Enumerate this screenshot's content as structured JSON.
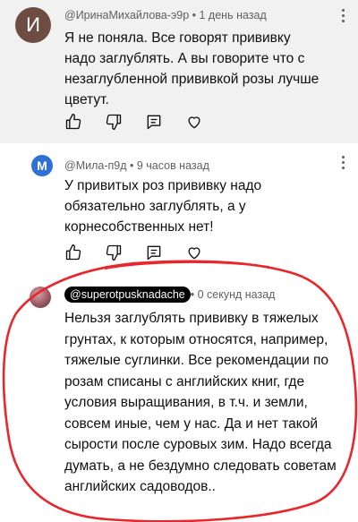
{
  "comments": [
    {
      "avatar_letter": "И",
      "avatar_color": "#6d4c41",
      "author": "@ИринаМихайлова-э9р",
      "time": " • 1 день назад",
      "lines": [
        "Я не поняла. Все говорят прививку",
        "надо заглублять. А вы говорите что с",
        "незаглубленной прививкой розы лучше",
        "цветут."
      ],
      "highlighted": true
    },
    {
      "avatar_letter": "M",
      "avatar_color": "#2f6fd8",
      "author": "@Мила-п9д",
      "time": " • 9 часов назад",
      "lines": [
        "У привитых роз прививку надо",
        "обязательно заглублять, а у",
        "корнесобственных нет!"
      ]
    },
    {
      "author": "@superotpusknadache",
      "time": " • 0 секунд назад",
      "lines": [
        "Нельзя заглублять прививку в тяжелых",
        "грунтах, к которым относятся, например,",
        "тяжелые суглинки. Все рекомендации по",
        "розам списаны с английских книг, где",
        "условия выращивания, в т.ч. и земли,",
        "совсем иные, чем у нас. Да и нет такой",
        "сырости после суровых зим. Надо всегда",
        "думать, а не бездумно следовать советам",
        "английских садоводов.."
      ]
    }
  ],
  "icons": [
    "like-icon",
    "dislike-icon",
    "reply-icon",
    "heart-icon",
    "more-vert-icon"
  ],
  "colors": {
    "annotation": "#e8262b",
    "meta_text": "#606060",
    "highlight_bg": "#f1f1f1"
  }
}
